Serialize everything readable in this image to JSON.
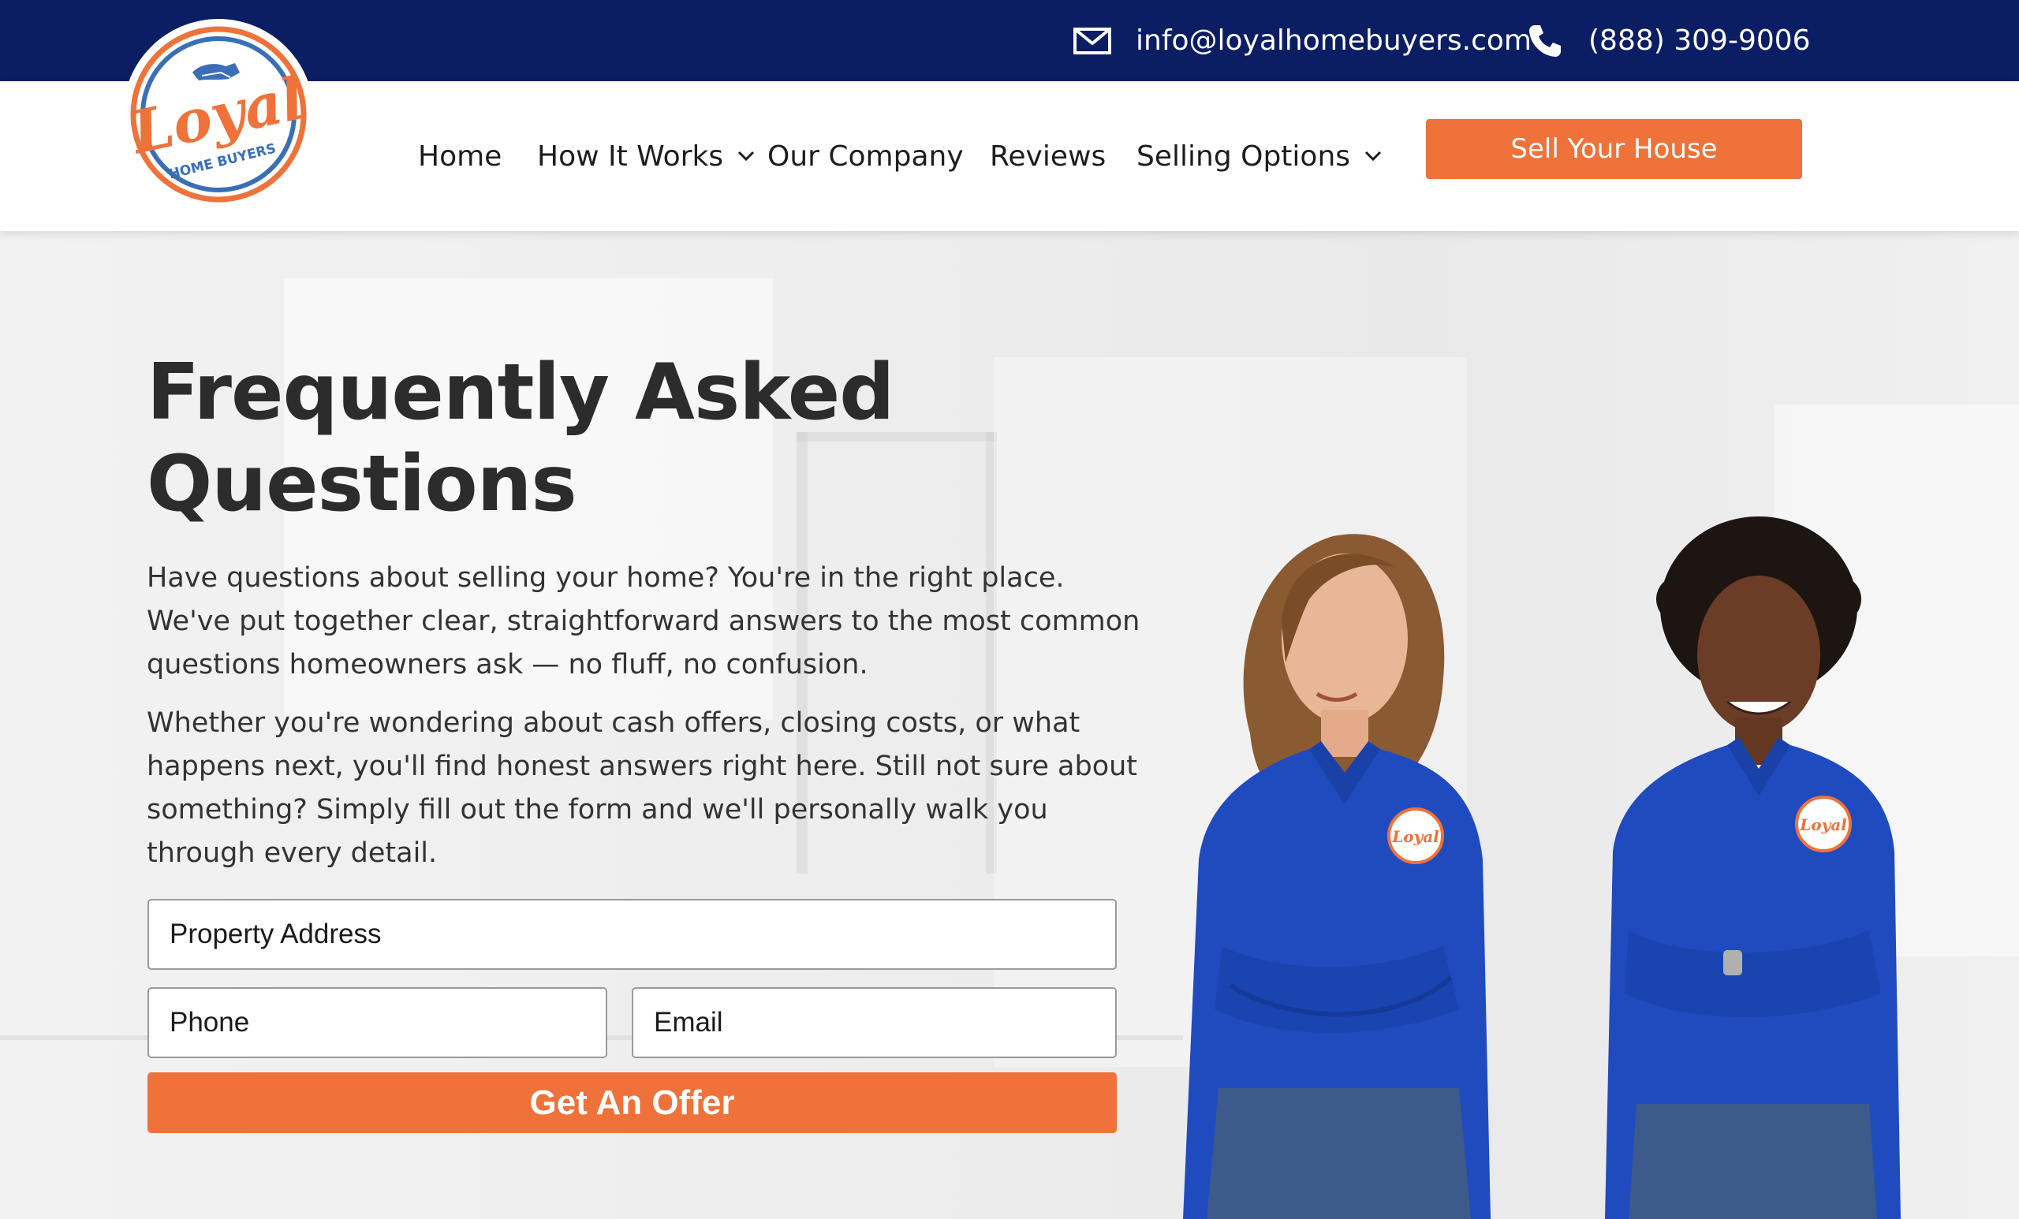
{
  "topbar": {
    "email": "info@loyalhomebuyers.com",
    "phone": "(888) 309-9006",
    "email_icon": "envelope-icon",
    "phone_icon": "phone-icon"
  },
  "logo": {
    "wordmark": "Loyal",
    "tagline": "HOME BUYERS"
  },
  "nav": {
    "items": [
      {
        "label": "Home"
      },
      {
        "label": "How It Works",
        "icon": "chevron-down-icon"
      },
      {
        "label": "Our Company"
      },
      {
        "label": "Reviews"
      },
      {
        "label": "Selling Options",
        "icon": "chevron-down-icon"
      }
    ],
    "cta": "Sell Your House"
  },
  "hero": {
    "title_line1": "Frequently Asked",
    "title_line2": "Questions",
    "paragraph1": "Have questions about selling your home? You're in the right place. We've put together clear, straightforward answers to the most common questions homeowners ask — no fluff, no confusion.",
    "paragraph2": "Whether you're wondering about cash offers, closing costs, or what happens next, you'll find honest answers right here. Still not sure about something? Simply fill out the form and we'll personally walk you through every detail."
  },
  "form": {
    "address_placeholder": "Property Address",
    "phone_placeholder": "Phone",
    "email_placeholder": "Email",
    "submit": "Get An Offer"
  },
  "colors": {
    "navy": "#0b1d63",
    "orange": "#ee7239",
    "blue_logo": "#3a6fb8",
    "shirt_blue": "#1f4bbf"
  }
}
